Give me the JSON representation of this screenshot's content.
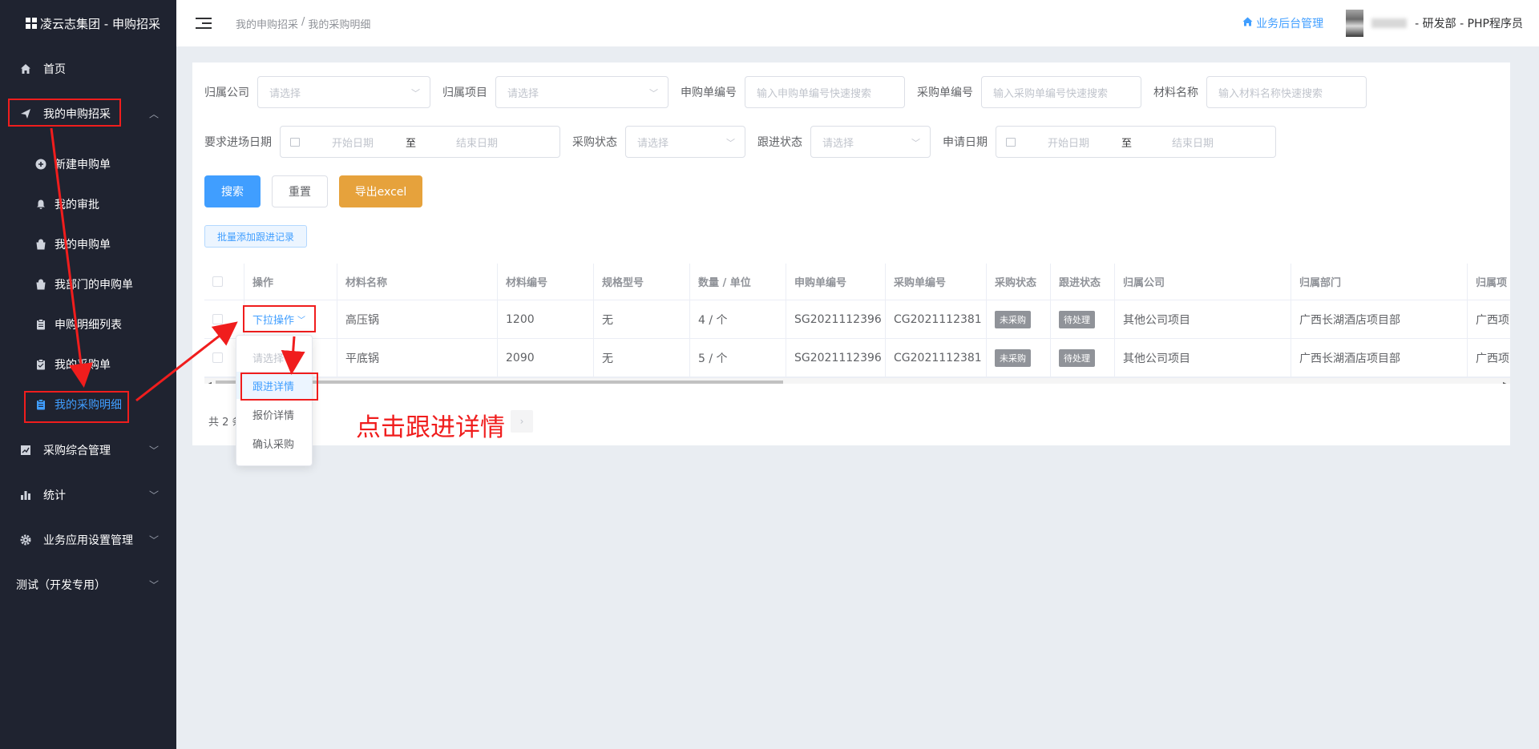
{
  "sidebar": {
    "brand": "凌云志集团 - 申购招采",
    "items": [
      {
        "label": "首页",
        "icon": "home-icon"
      },
      {
        "label": "我的申购招采",
        "icon": "send-icon",
        "expanded": true
      },
      {
        "label": "采购综合管理",
        "icon": "chart-icon"
      },
      {
        "label": "统计",
        "icon": "bar-chart-icon"
      },
      {
        "label": "业务应用设置管理",
        "icon": "gear-icon"
      },
      {
        "label": "测试（开发专用）",
        "icon": ""
      }
    ],
    "subitems": [
      {
        "label": "新建申购单",
        "icon": "plus-circle-icon"
      },
      {
        "label": "我的审批",
        "icon": "bell-icon"
      },
      {
        "label": "我的申购单",
        "icon": "bag-icon"
      },
      {
        "label": "我部门的申购单",
        "icon": "bag-icon"
      },
      {
        "label": "申购明细列表",
        "icon": "clipboard-icon"
      },
      {
        "label": "我的采购单",
        "icon": "clipboard-check-icon"
      },
      {
        "label": "我的采购明细",
        "icon": "clipboard-icon",
        "active": true
      }
    ]
  },
  "header": {
    "breadcrumb": [
      "我的申购招采",
      "/",
      "我的采购明细"
    ],
    "backend_link": "业务后台管理",
    "user_text": "- 研发部 - PHP程序员"
  },
  "filters": {
    "company_label": "归属公司",
    "company_placeholder": "请选择",
    "project_label": "归属项目",
    "project_placeholder": "请选择",
    "req_no_label": "申购单编号",
    "req_no_placeholder": "输入申购单编号快速搜索",
    "po_no_label": "采购单编号",
    "po_no_placeholder": "输入采购单编号快速搜索",
    "material_label": "材料名称",
    "material_placeholder": "输入材料名称快速搜索",
    "arrival_label": "要求进场日期",
    "start_placeholder": "开始日期",
    "to": "至",
    "end_placeholder": "结束日期",
    "purchase_status_label": "采购状态",
    "purchase_status_placeholder": "请选择",
    "follow_status_label": "跟进状态",
    "follow_status_placeholder": "请选择",
    "apply_date_label": "申请日期"
  },
  "buttons": {
    "search": "搜索",
    "reset": "重置",
    "export": "导出excel",
    "batch_follow": "批量添加跟进记录"
  },
  "table": {
    "columns": [
      "操作",
      "材料名称",
      "材料编号",
      "规格型号",
      "数量 / 单位",
      "申购单编号",
      "采购单编号",
      "采购状态",
      "跟进状态",
      "归属公司",
      "归属部门",
      "归属项"
    ],
    "rows": [
      [
        "下拉操作",
        "高压锅",
        "1200",
        "无",
        "4 / 个",
        "SG2021112396",
        "CG2021112381",
        "未采购",
        "待处理",
        "其他公司项目",
        "广西长湖酒店项目部",
        "广西项"
      ],
      [
        "",
        "平底锅",
        "2090",
        "无",
        "5 / 个",
        "SG2021112396",
        "CG2021112381",
        "未采购",
        "待处理",
        "其他公司项目",
        "广西长湖酒店项目部",
        "广西项"
      ]
    ]
  },
  "pagination": {
    "total_prefix": "共 2 条"
  },
  "dropdown_menu": {
    "items": [
      "请选择",
      "跟进详情",
      "报价详情",
      "确认采购"
    ]
  },
  "annotation": "点击跟进详情",
  "colors": {
    "primary": "#409eff",
    "warning": "#e6a23c",
    "sidebar_bg": "#1f2330",
    "annotation_red": "#f01d1d"
  }
}
